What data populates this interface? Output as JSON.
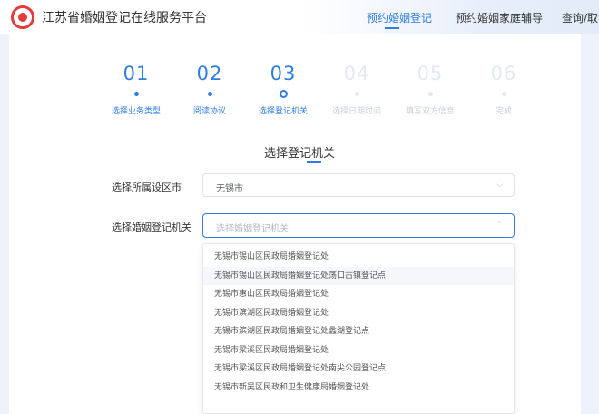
{
  "header": {
    "site_title": "江苏省婚姻登记在线服务平台",
    "nav": [
      {
        "label": "预约婚姻登记",
        "active": true
      },
      {
        "label": "预约婚姻家庭辅导",
        "active": false
      },
      {
        "label": "查询/取消",
        "active": false
      }
    ]
  },
  "steps": [
    {
      "num": "01",
      "label": "选择业务类型",
      "state": "done"
    },
    {
      "num": "02",
      "label": "阅读协议",
      "state": "done"
    },
    {
      "num": "03",
      "label": "选择登记机关",
      "state": "current"
    },
    {
      "num": "04",
      "label": "选择日期时间",
      "state": "todo"
    },
    {
      "num": "05",
      "label": "填写双方信息",
      "state": "todo"
    },
    {
      "num": "06",
      "label": "完成",
      "state": "todo"
    }
  ],
  "section": {
    "title": "选择登记机关"
  },
  "form": {
    "city_label": "选择所属设区市",
    "city_value": "无锡市",
    "office_label": "选择婚姻登记机关",
    "office_placeholder": "选择婚姻登记机关"
  },
  "dropdown": {
    "options": [
      "无锡市锡山区民政局婚姻登记处",
      "无锡市锡山区民政局婚姻登记处荡口古镇登记点",
      "无锡市惠山区民政局婚姻登记处",
      "无锡市滨湖区民政局婚姻登记处",
      "无锡市滨湖区民政局婚姻登记处蠡湖登记点",
      "无锡市梁溪区民政局婚姻登记处",
      "无锡市梁溪区民政局婚姻登记处南尖公园登记点",
      "无锡市新吴区民政和卫生健康局婚姻登记处"
    ],
    "hover_index": 1
  },
  "colors": {
    "accent": "#2f7de1",
    "logo": "#e23b3b"
  }
}
